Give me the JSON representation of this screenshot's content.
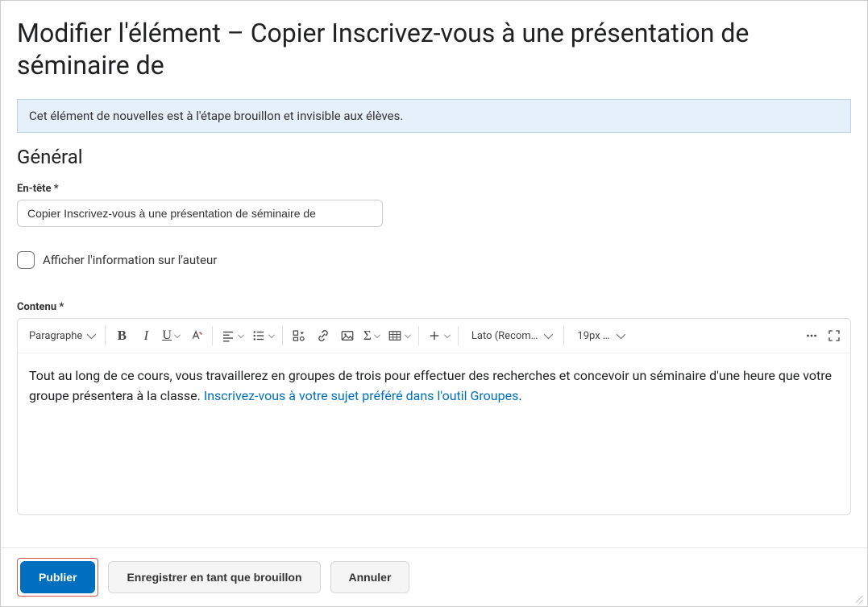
{
  "page_title": "Modifier l'élément – Copier Inscrivez-vous à une présentation de séminaire de",
  "banner_text": "Cet élément de nouvelles est à l'étape brouillon et invisible aux élèves.",
  "section_general": "Général",
  "header_field": {
    "label": "En-tête *",
    "value": "Copier Inscrivez-vous à une présentation de séminaire de"
  },
  "author_checkbox_label": "Afficher l'information sur l'auteur",
  "content_field": {
    "label": "Contenu *"
  },
  "toolbar": {
    "paragraph_label": "Paragraphe",
    "font_family_label": "Lato (Recom…",
    "font_size_label": "19px …"
  },
  "editor_body": {
    "text_before_link": "Tout au long de ce cours, vous travaillerez en groupes de trois pour effectuer des recherches et concevoir un séminaire d'une heure que votre groupe présentera à la classe. ",
    "link_text": "Inscrivez-vous à votre sujet préféré dans l'outil Groupes",
    "text_after_link": "."
  },
  "footer": {
    "publish": "Publier",
    "save_draft": "Enregistrer en tant que brouillon",
    "cancel": "Annuler"
  }
}
